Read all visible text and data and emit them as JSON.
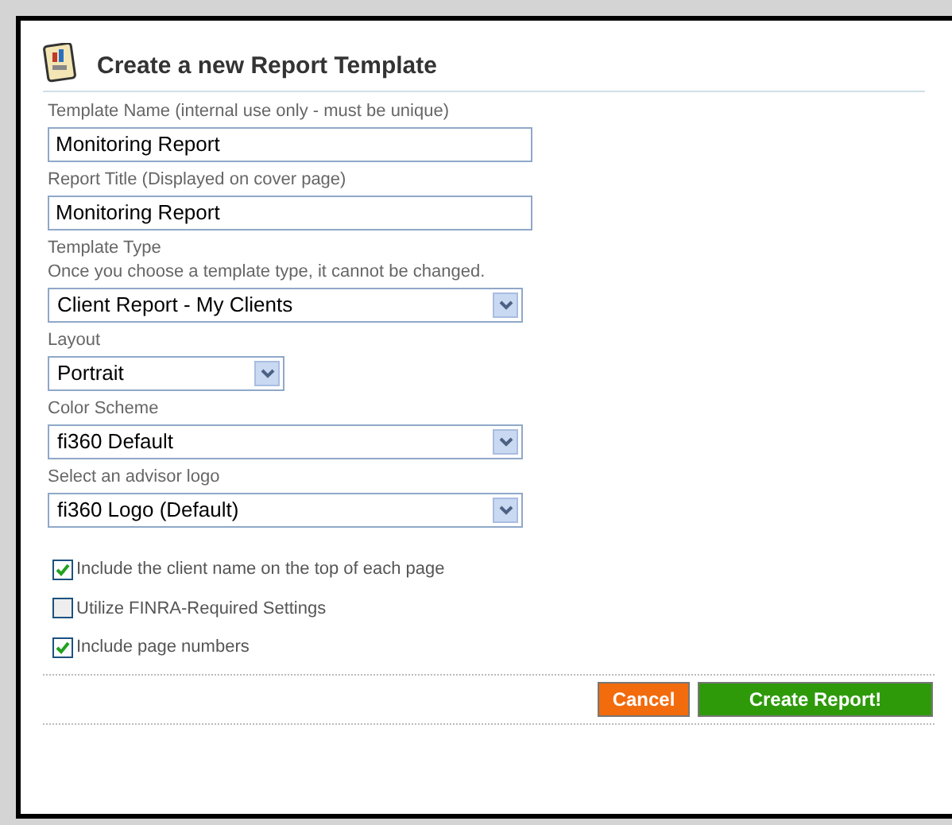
{
  "title": "Create a new Report Template",
  "fields": [
    {
      "kind": "text",
      "label": "Template Name (internal use only - must be unique)",
      "value": "Monitoring Report"
    },
    {
      "kind": "text",
      "label": "Report Title (Displayed on cover page)",
      "value": "Monitoring Report"
    },
    {
      "kind": "select",
      "label": "Template Type",
      "hint": "Once you choose a template type, it cannot be changed.",
      "value": "Client Report - My Clients"
    },
    {
      "kind": "short-select",
      "label": "Layout",
      "value": "Portrait"
    },
    {
      "kind": "select",
      "label": "Color Scheme",
      "value": "fi360 Default"
    },
    {
      "kind": "select",
      "label": "Select an advisor logo",
      "value": "fi360 Logo (Default)"
    }
  ],
  "checkboxes": [
    {
      "label": "Include the client name on the top of each page",
      "checked": true
    },
    {
      "label": "Utilize FINRA-Required Settings",
      "checked": false
    },
    {
      "label": "Include page numbers",
      "checked": true
    }
  ],
  "buttons": [
    {
      "kind": "cancel",
      "label": "Cancel"
    },
    {
      "kind": "primary",
      "label": "Create Report!"
    }
  ]
}
